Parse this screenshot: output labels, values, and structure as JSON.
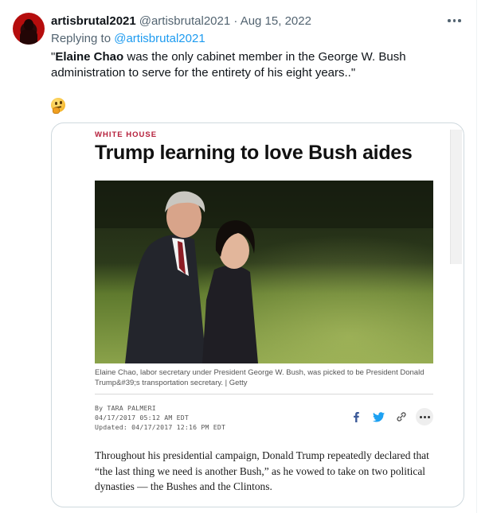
{
  "tweet": {
    "display_name": "artisbrutal2021",
    "meta": "@artisbrutal2021 · Aug 15, 2022",
    "replying_prefix": "Replying to",
    "replying_handle": "@artisbrutal2021",
    "quote_open": "\"",
    "quote_bold": "Elaine Chao",
    "quote_rest": " was the only cabinet member in the George W. Bush administration to serve for the entirety of his eight years..\"",
    "emoji_icon": "thinking-face-icon",
    "more_icon": "more-horizontal-icon"
  },
  "article": {
    "section": "WHITE HOUSE",
    "headline": "Trump learning to love Bush aides",
    "caption": "Elaine Chao, labor secretary under President George W. Bush, was picked to be President Donald Trump&#39;s transportation secretary. | Getty",
    "byline": "By TARA PALMERI",
    "published": "04/17/2017 05:12 AM EDT",
    "updated": "Updated: 04/17/2017 12:16 PM EDT",
    "share_icons": [
      "facebook-icon",
      "twitter-icon",
      "link-icon",
      "more-icon"
    ],
    "body": "Throughout his presidential campaign, Donald Trump repeatedly declared that “the last thing we need is another Bush,” as he vowed to take on two political dynasties — the Bushes and the Clintons."
  },
  "colors": {
    "link_blue": "#1d9bf0",
    "muted_text": "#536471",
    "section_red": "#b51e3a",
    "facebook_blue": "#3b5998",
    "twitter_blue": "#1da1f2"
  }
}
